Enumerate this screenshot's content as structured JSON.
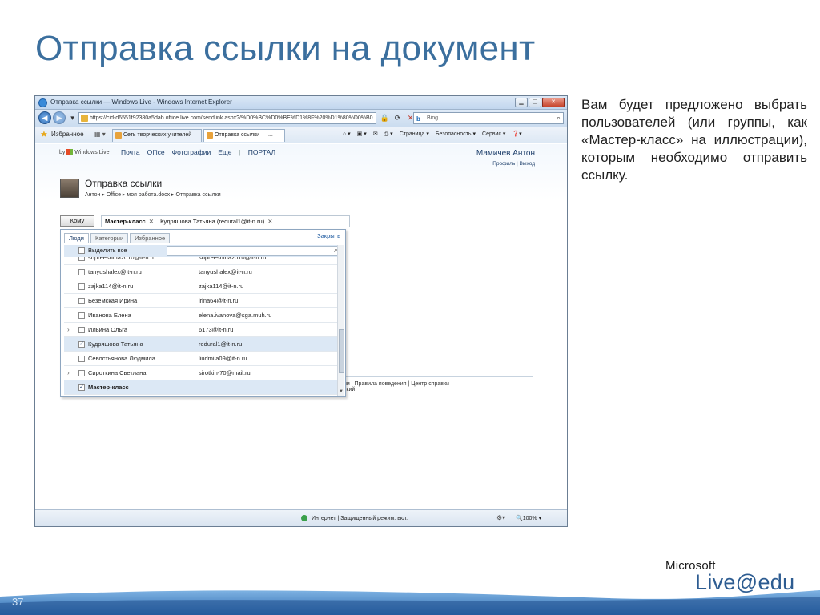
{
  "slide": {
    "title": "Отправка ссылки на документ",
    "number": "37",
    "side_text": "Вам будет предложено выбрать пользователей (или группы, как «Мастер-класс» на иллюстрации), которым необходимо отправить ссылку.",
    "brand_top": "Microsoft",
    "brand_bottom": "Live@edu"
  },
  "browser": {
    "window_title": "Отправка ссылки — Windows Live - Windows Internet Explorer",
    "address": "https://cid-d6551f92380a5dab.office.live.com/sendlink.aspx?/%D0%BC%D0%BE%D1%8F%20%D1%80%D0%B0",
    "search_engine": "Bing",
    "favorites_label": "Избранное",
    "tabs": [
      "Сеть творческих учителей",
      "Отправка ссылки — ..."
    ],
    "commands": [
      "Страница ▾",
      "Безопасность ▾",
      "Сервис ▾"
    ],
    "status_text": "Интернет | Защищенный режим: вкл.",
    "zoom": "100%"
  },
  "page": {
    "nav": [
      "Почта",
      "Office",
      "Фотографии",
      "Еще",
      "ПОРТАЛ"
    ],
    "logo_text": "Windows Live",
    "user_name": "Мамичев Антон",
    "user_links": "Профиль | Выход",
    "title": "Отправка ссылки",
    "breadcrumb": "Антон ▸ Office ▸ моя работа.docx ▸ Отправка ссылки",
    "to_button": "Кому",
    "recipients": [
      "Мастер-класс",
      "Кудряшова Татьяна  (redural1@it-n.ru)"
    ],
    "footer_links": "ии | Правила поведения | Центр справки",
    "footer_tail": "ский"
  },
  "picker": {
    "tabs": [
      "Люди",
      "Категории",
      "Избранное"
    ],
    "close_label": "Закрыть",
    "select_all": "Выделить все",
    "rows": [
      {
        "name": "sopreeshina2010@it-n.ru",
        "email": "sopreeshina2010@it-n.ru",
        "checked": false,
        "expander": false
      },
      {
        "name": "tanyushalex@it-n.ru",
        "email": "tanyushalex@it-n.ru",
        "checked": false,
        "expander": false
      },
      {
        "name": "zajka114@it-n.ru",
        "email": "zajka114@it-n.ru",
        "checked": false,
        "expander": false
      },
      {
        "name": "Беземская Ирина",
        "email": "irina64@it-n.ru",
        "checked": false,
        "expander": false
      },
      {
        "name": "Иванова Елена",
        "email": "elena.ivanova@sga.muh.ru",
        "checked": false,
        "expander": false
      },
      {
        "name": "Ильина Ольга",
        "email": "6173@it-n.ru",
        "checked": false,
        "expander": true
      },
      {
        "name": "Кудряшова Татьяна",
        "email": "redural1@it-n.ru",
        "checked": true,
        "expander": false
      },
      {
        "name": "Севостьянова Людмила",
        "email": "liudmila09@it-n.ru",
        "checked": false,
        "expander": false
      },
      {
        "name": "Сироткина Светлана",
        "email": "sirotkin-70@mail.ru",
        "checked": false,
        "expander": true
      },
      {
        "name": "Мастер-класс",
        "email": "",
        "checked": true,
        "expander": false
      }
    ]
  }
}
